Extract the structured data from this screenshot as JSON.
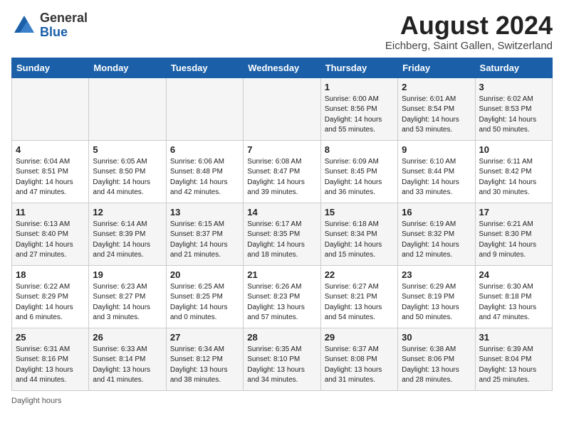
{
  "header": {
    "logo_general": "General",
    "logo_blue": "Blue",
    "month_year": "August 2024",
    "location": "Eichberg, Saint Gallen, Switzerland"
  },
  "days_of_week": [
    "Sunday",
    "Monday",
    "Tuesday",
    "Wednesday",
    "Thursday",
    "Friday",
    "Saturday"
  ],
  "weeks": [
    [
      {
        "day": "",
        "info": ""
      },
      {
        "day": "",
        "info": ""
      },
      {
        "day": "",
        "info": ""
      },
      {
        "day": "",
        "info": ""
      },
      {
        "day": "1",
        "info": "Sunrise: 6:00 AM\nSunset: 8:56 PM\nDaylight: 14 hours\nand 55 minutes."
      },
      {
        "day": "2",
        "info": "Sunrise: 6:01 AM\nSunset: 8:54 PM\nDaylight: 14 hours\nand 53 minutes."
      },
      {
        "day": "3",
        "info": "Sunrise: 6:02 AM\nSunset: 8:53 PM\nDaylight: 14 hours\nand 50 minutes."
      }
    ],
    [
      {
        "day": "4",
        "info": "Sunrise: 6:04 AM\nSunset: 8:51 PM\nDaylight: 14 hours\nand 47 minutes."
      },
      {
        "day": "5",
        "info": "Sunrise: 6:05 AM\nSunset: 8:50 PM\nDaylight: 14 hours\nand 44 minutes."
      },
      {
        "day": "6",
        "info": "Sunrise: 6:06 AM\nSunset: 8:48 PM\nDaylight: 14 hours\nand 42 minutes."
      },
      {
        "day": "7",
        "info": "Sunrise: 6:08 AM\nSunset: 8:47 PM\nDaylight: 14 hours\nand 39 minutes."
      },
      {
        "day": "8",
        "info": "Sunrise: 6:09 AM\nSunset: 8:45 PM\nDaylight: 14 hours\nand 36 minutes."
      },
      {
        "day": "9",
        "info": "Sunrise: 6:10 AM\nSunset: 8:44 PM\nDaylight: 14 hours\nand 33 minutes."
      },
      {
        "day": "10",
        "info": "Sunrise: 6:11 AM\nSunset: 8:42 PM\nDaylight: 14 hours\nand 30 minutes."
      }
    ],
    [
      {
        "day": "11",
        "info": "Sunrise: 6:13 AM\nSunset: 8:40 PM\nDaylight: 14 hours\nand 27 minutes."
      },
      {
        "day": "12",
        "info": "Sunrise: 6:14 AM\nSunset: 8:39 PM\nDaylight: 14 hours\nand 24 minutes."
      },
      {
        "day": "13",
        "info": "Sunrise: 6:15 AM\nSunset: 8:37 PM\nDaylight: 14 hours\nand 21 minutes."
      },
      {
        "day": "14",
        "info": "Sunrise: 6:17 AM\nSunset: 8:35 PM\nDaylight: 14 hours\nand 18 minutes."
      },
      {
        "day": "15",
        "info": "Sunrise: 6:18 AM\nSunset: 8:34 PM\nDaylight: 14 hours\nand 15 minutes."
      },
      {
        "day": "16",
        "info": "Sunrise: 6:19 AM\nSunset: 8:32 PM\nDaylight: 14 hours\nand 12 minutes."
      },
      {
        "day": "17",
        "info": "Sunrise: 6:21 AM\nSunset: 8:30 PM\nDaylight: 14 hours\nand 9 minutes."
      }
    ],
    [
      {
        "day": "18",
        "info": "Sunrise: 6:22 AM\nSunset: 8:29 PM\nDaylight: 14 hours\nand 6 minutes."
      },
      {
        "day": "19",
        "info": "Sunrise: 6:23 AM\nSunset: 8:27 PM\nDaylight: 14 hours\nand 3 minutes."
      },
      {
        "day": "20",
        "info": "Sunrise: 6:25 AM\nSunset: 8:25 PM\nDaylight: 14 hours\nand 0 minutes."
      },
      {
        "day": "21",
        "info": "Sunrise: 6:26 AM\nSunset: 8:23 PM\nDaylight: 13 hours\nand 57 minutes."
      },
      {
        "day": "22",
        "info": "Sunrise: 6:27 AM\nSunset: 8:21 PM\nDaylight: 13 hours\nand 54 minutes."
      },
      {
        "day": "23",
        "info": "Sunrise: 6:29 AM\nSunset: 8:19 PM\nDaylight: 13 hours\nand 50 minutes."
      },
      {
        "day": "24",
        "info": "Sunrise: 6:30 AM\nSunset: 8:18 PM\nDaylight: 13 hours\nand 47 minutes."
      }
    ],
    [
      {
        "day": "25",
        "info": "Sunrise: 6:31 AM\nSunset: 8:16 PM\nDaylight: 13 hours\nand 44 minutes."
      },
      {
        "day": "26",
        "info": "Sunrise: 6:33 AM\nSunset: 8:14 PM\nDaylight: 13 hours\nand 41 minutes."
      },
      {
        "day": "27",
        "info": "Sunrise: 6:34 AM\nSunset: 8:12 PM\nDaylight: 13 hours\nand 38 minutes."
      },
      {
        "day": "28",
        "info": "Sunrise: 6:35 AM\nSunset: 8:10 PM\nDaylight: 13 hours\nand 34 minutes."
      },
      {
        "day": "29",
        "info": "Sunrise: 6:37 AM\nSunset: 8:08 PM\nDaylight: 13 hours\nand 31 minutes."
      },
      {
        "day": "30",
        "info": "Sunrise: 6:38 AM\nSunset: 8:06 PM\nDaylight: 13 hours\nand 28 minutes."
      },
      {
        "day": "31",
        "info": "Sunrise: 6:39 AM\nSunset: 8:04 PM\nDaylight: 13 hours\nand 25 minutes."
      }
    ]
  ],
  "footer": {
    "text": "Daylight hours"
  }
}
